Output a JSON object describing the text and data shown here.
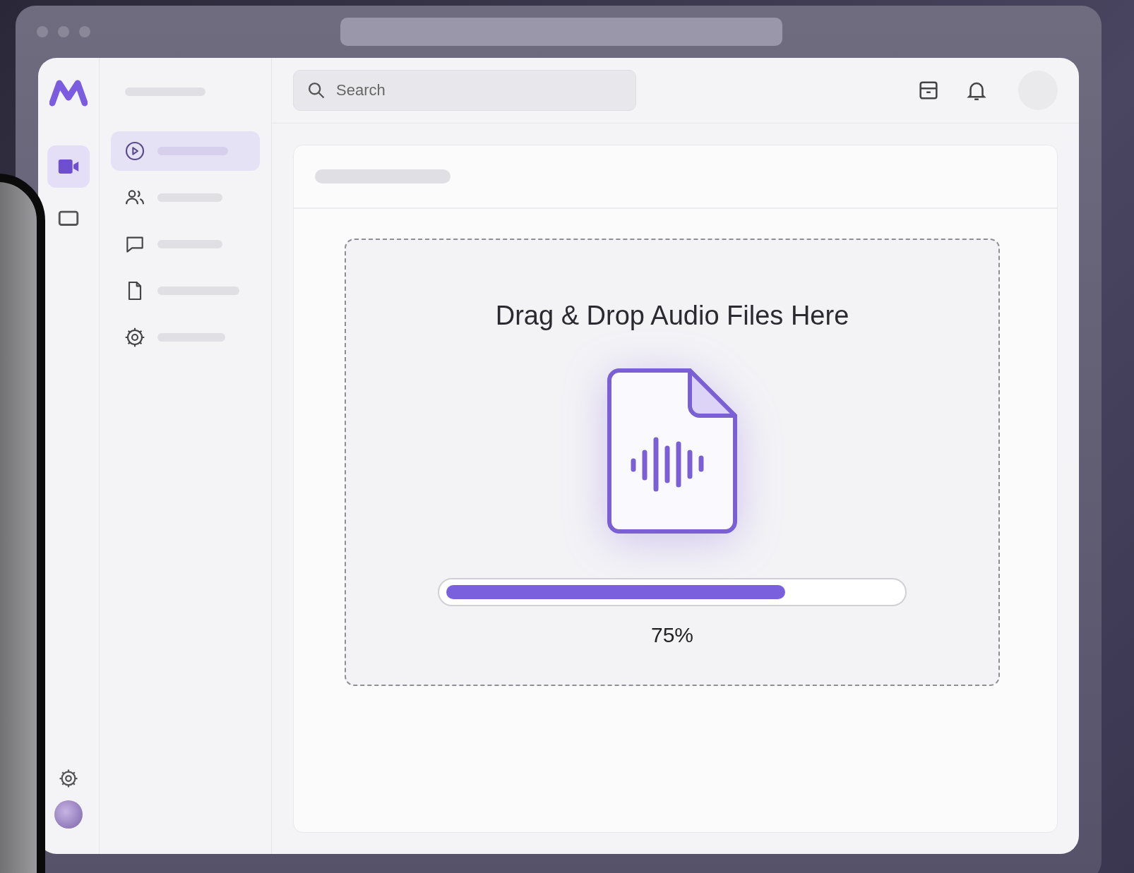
{
  "rail": {
    "items": [
      {
        "selected": true
      },
      {
        "selected": false
      }
    ]
  },
  "nav": {
    "items": [
      {
        "selected": true
      },
      {
        "selected": false
      },
      {
        "selected": false
      },
      {
        "selected": false
      },
      {
        "selected": false
      }
    ]
  },
  "search": {
    "placeholder": "Search"
  },
  "upload": {
    "title": "Drag & Drop Audio Files Here",
    "level": 0.75,
    "reading": "75%"
  }
}
